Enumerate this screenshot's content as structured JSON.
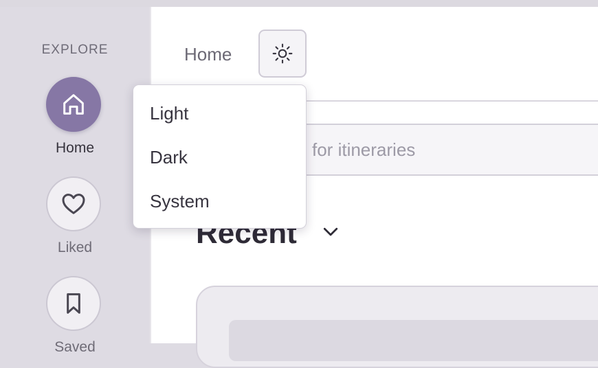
{
  "sidebar": {
    "section_label": "EXPLORE",
    "items": [
      {
        "label": "Home",
        "icon": "home-icon",
        "active": true
      },
      {
        "label": "Liked",
        "icon": "heart-icon",
        "active": false
      },
      {
        "label": "Saved",
        "icon": "bookmark-icon",
        "active": false
      }
    ]
  },
  "header": {
    "breadcrumb": "Home",
    "theme_button_icon": "sun-icon"
  },
  "search": {
    "placeholder_visible": "for itineraries"
  },
  "main": {
    "section_title": "Recent"
  },
  "theme_menu": {
    "options": [
      "Light",
      "Dark",
      "System"
    ]
  },
  "colors": {
    "accent": "#8677a5",
    "sidebar_bg": "#dedbe3",
    "text_dark": "#36333d"
  }
}
